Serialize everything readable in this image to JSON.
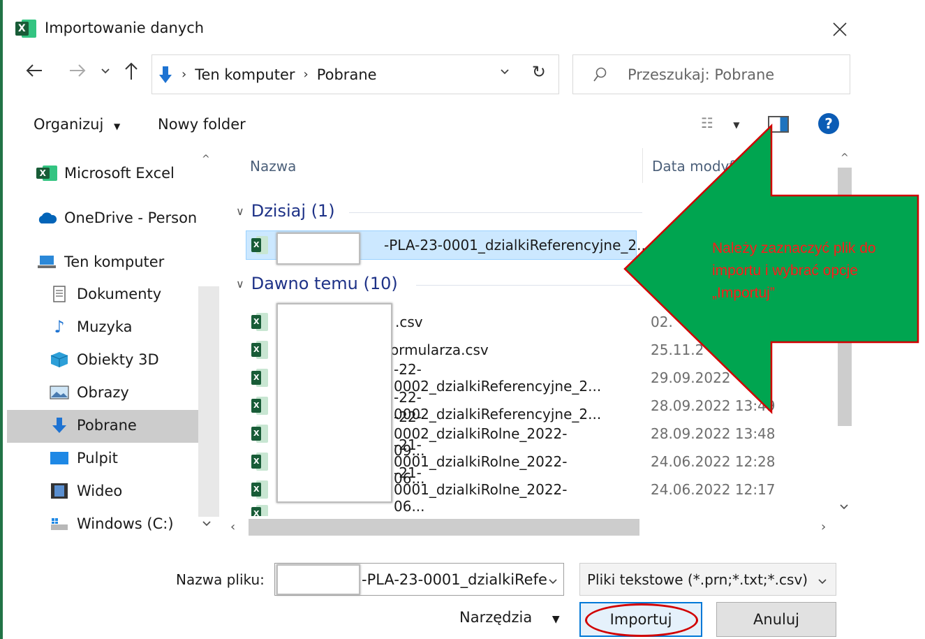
{
  "window": {
    "title": "Importowanie danych",
    "app_icon_letter": "X"
  },
  "nav": {
    "breadcrumb": [
      "Ten komputer",
      "Pobrane"
    ],
    "search_placeholder": "Przeszukaj: Pobrane"
  },
  "toolbar": {
    "organize_label": "Organizuj",
    "new_folder_label": "Nowy folder",
    "help_label": "?"
  },
  "sidebar": {
    "items": [
      {
        "label": "Microsoft Excel",
        "icon": "excel-icon"
      },
      {
        "label": "OneDrive - Person",
        "icon": "cloud-icon"
      },
      {
        "label": "Ten komputer",
        "icon": "computer-icon"
      },
      {
        "label": "Dokumenty",
        "icon": "document-icon"
      },
      {
        "label": "Muzyka",
        "icon": "music-icon"
      },
      {
        "label": "Obiekty 3D",
        "icon": "cube-icon"
      },
      {
        "label": "Obrazy",
        "icon": "picture-icon"
      },
      {
        "label": "Pobrane",
        "icon": "download-icon",
        "selected": true
      },
      {
        "label": "Pulpit",
        "icon": "desktop-icon"
      },
      {
        "label": "Wideo",
        "icon": "video-icon"
      },
      {
        "label": "Windows (C:)",
        "icon": "drive-icon"
      }
    ]
  },
  "file_list": {
    "columns": {
      "name": "Nazwa",
      "date": "Data modyfikacji"
    },
    "groups": [
      {
        "label": "Dzisiaj (1)",
        "files": [
          {
            "name": "-PLA-23-0001_dzialkiReferencyjne_2...",
            "date": "",
            "selected": true
          }
        ]
      },
      {
        "label": "Dawno temu (10)",
        "files": [
          {
            "name": ".csv",
            "date": "02."
          },
          {
            "name": "formularza.csv",
            "date": "25.11.2"
          },
          {
            "name": "-22-0002_dzialkiReferencyjne_2...",
            "date": "29.09.2022"
          },
          {
            "name": "-22-0002_dzialkiReferencyjne_2...",
            "date": "28.09.2022 13:49"
          },
          {
            "name": "-22-0002_dzialkiRolne_2022-09...",
            "date": "28.09.2022 13:48"
          },
          {
            "name": "-21-0001_dzialkiRolne_2022-06...",
            "date": "24.06.2022 12:28"
          },
          {
            "name": "-21-0001_dzialkiRolne_2022-06...",
            "date": "24.06.2022 12:17"
          }
        ]
      }
    ]
  },
  "bottom": {
    "filename_label": "Nazwa pliku:",
    "filename_value": "-PLA-23-0001_dzialkiRefe",
    "filetype_value": "Pliki tekstowe (*.prn;*.txt;*.csv)",
    "tools_label": "Narzędzia",
    "import_label": "Importuj",
    "cancel_label": "Anuluj"
  },
  "annotation": {
    "text": "Należy zaznaczyć plik do importu i wybrać opcje „Importuj”",
    "arrow_color": "#00a550",
    "border_color": "#d10000",
    "text_color": "#ff1a1a"
  },
  "colors": {
    "excel_green": "#217346",
    "selection": "#cce8ff",
    "group_header": "#1e3287"
  }
}
